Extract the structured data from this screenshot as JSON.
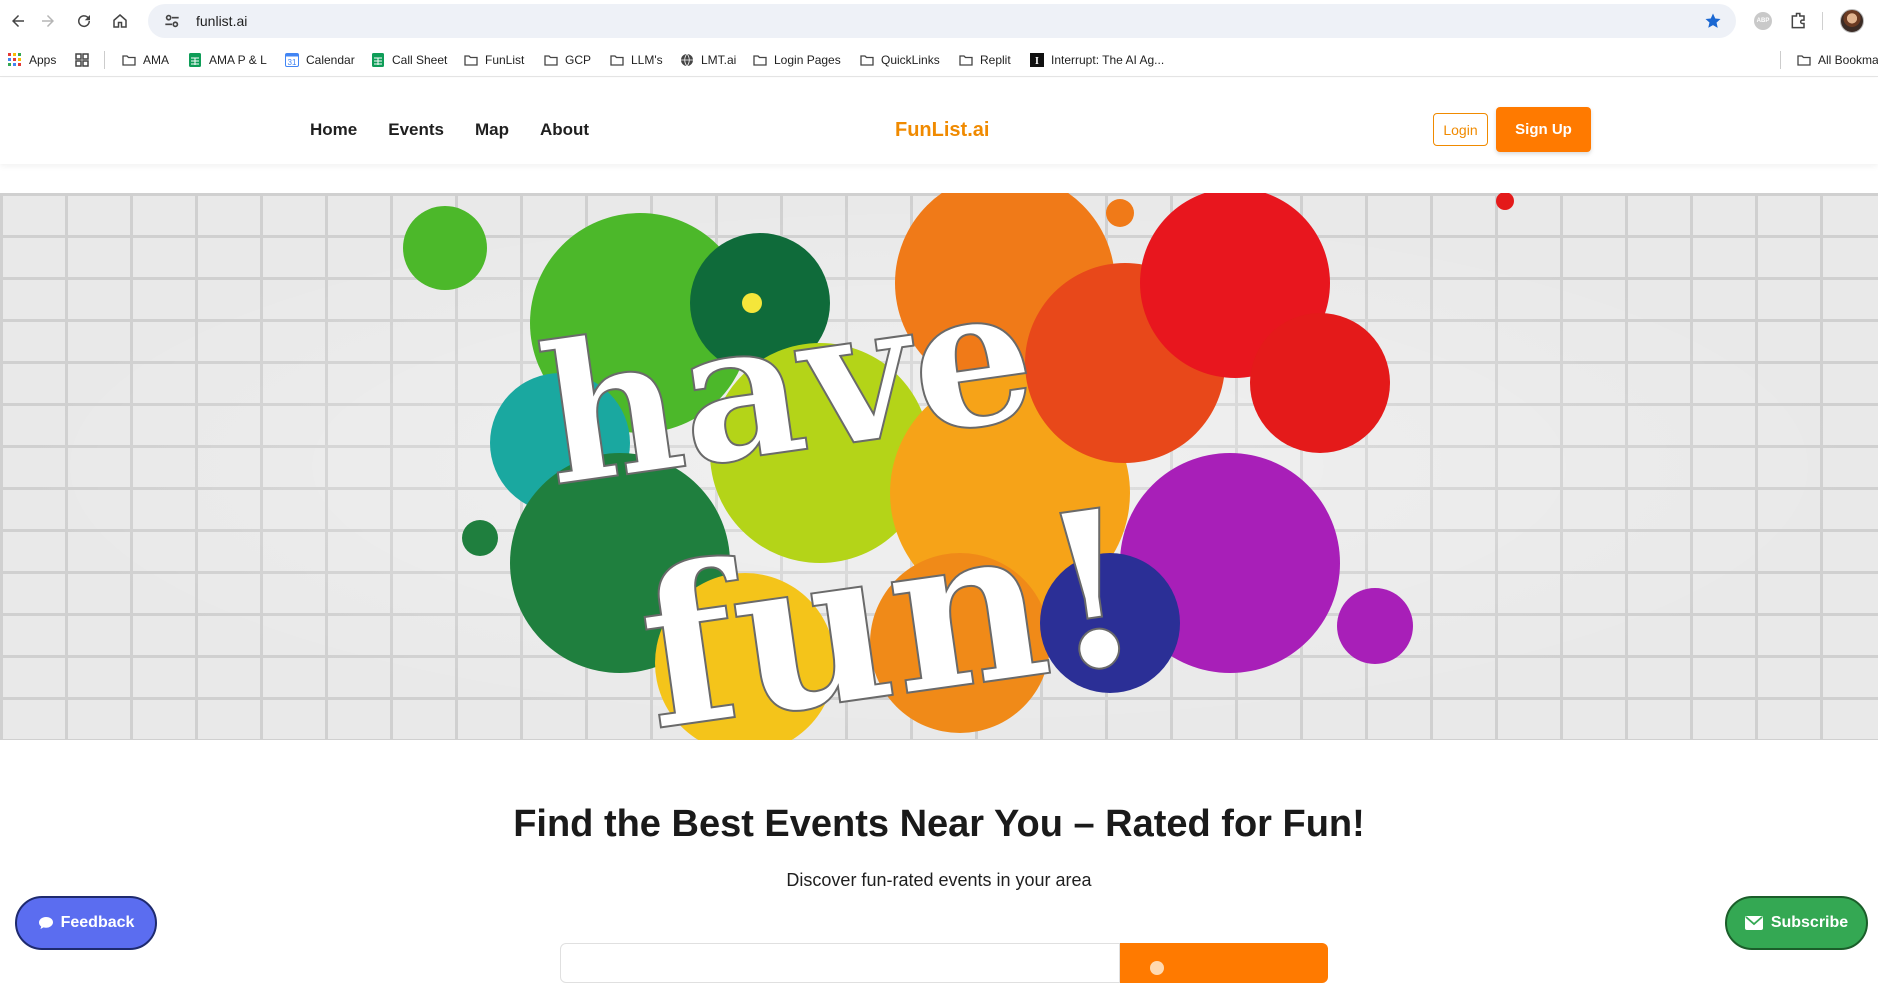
{
  "browser": {
    "url": "funlist.ai",
    "bookmarks": [
      {
        "label": "Apps",
        "icon": "apps-grid-icon"
      },
      {
        "label": "",
        "icon": "tab-groups-icon"
      },
      {
        "label": "AMA",
        "icon": "folder-icon"
      },
      {
        "label": "AMA P & L",
        "icon": "sheets-icon"
      },
      {
        "label": "Calendar",
        "icon": "calendar-icon"
      },
      {
        "label": "Call Sheet",
        "icon": "sheets-icon"
      },
      {
        "label": "FunList",
        "icon": "folder-icon"
      },
      {
        "label": "GCP",
        "icon": "folder-icon"
      },
      {
        "label": "LLM's",
        "icon": "folder-icon"
      },
      {
        "label": "LMT.ai",
        "icon": "globe-icon"
      },
      {
        "label": "Login Pages",
        "icon": "folder-icon"
      },
      {
        "label": "QuickLinks",
        "icon": "folder-icon"
      },
      {
        "label": "Replit",
        "icon": "folder-icon"
      },
      {
        "label": "Interrupt: The AI Ag...",
        "icon": "interrupt-icon"
      }
    ],
    "all_bookmarks_label": "All Bookmarks"
  },
  "site": {
    "brand": "FunList.ai",
    "nav": [
      "Home",
      "Events",
      "Map",
      "About"
    ],
    "login_label": "Login",
    "signup_label": "Sign Up",
    "hero_text_line1": "have",
    "hero_text_line2": "fun!",
    "headline": "Find the Best Events Near You – Rated for Fun!",
    "subline": "Discover fun-rated events in your area",
    "feedback_label": "Feedback",
    "subscribe_label": "Subscribe"
  },
  "colors": {
    "brand": "#f08a00",
    "primary_button": "#ff7a00",
    "feedback": "#5b6df0",
    "subscribe": "#34a853"
  }
}
